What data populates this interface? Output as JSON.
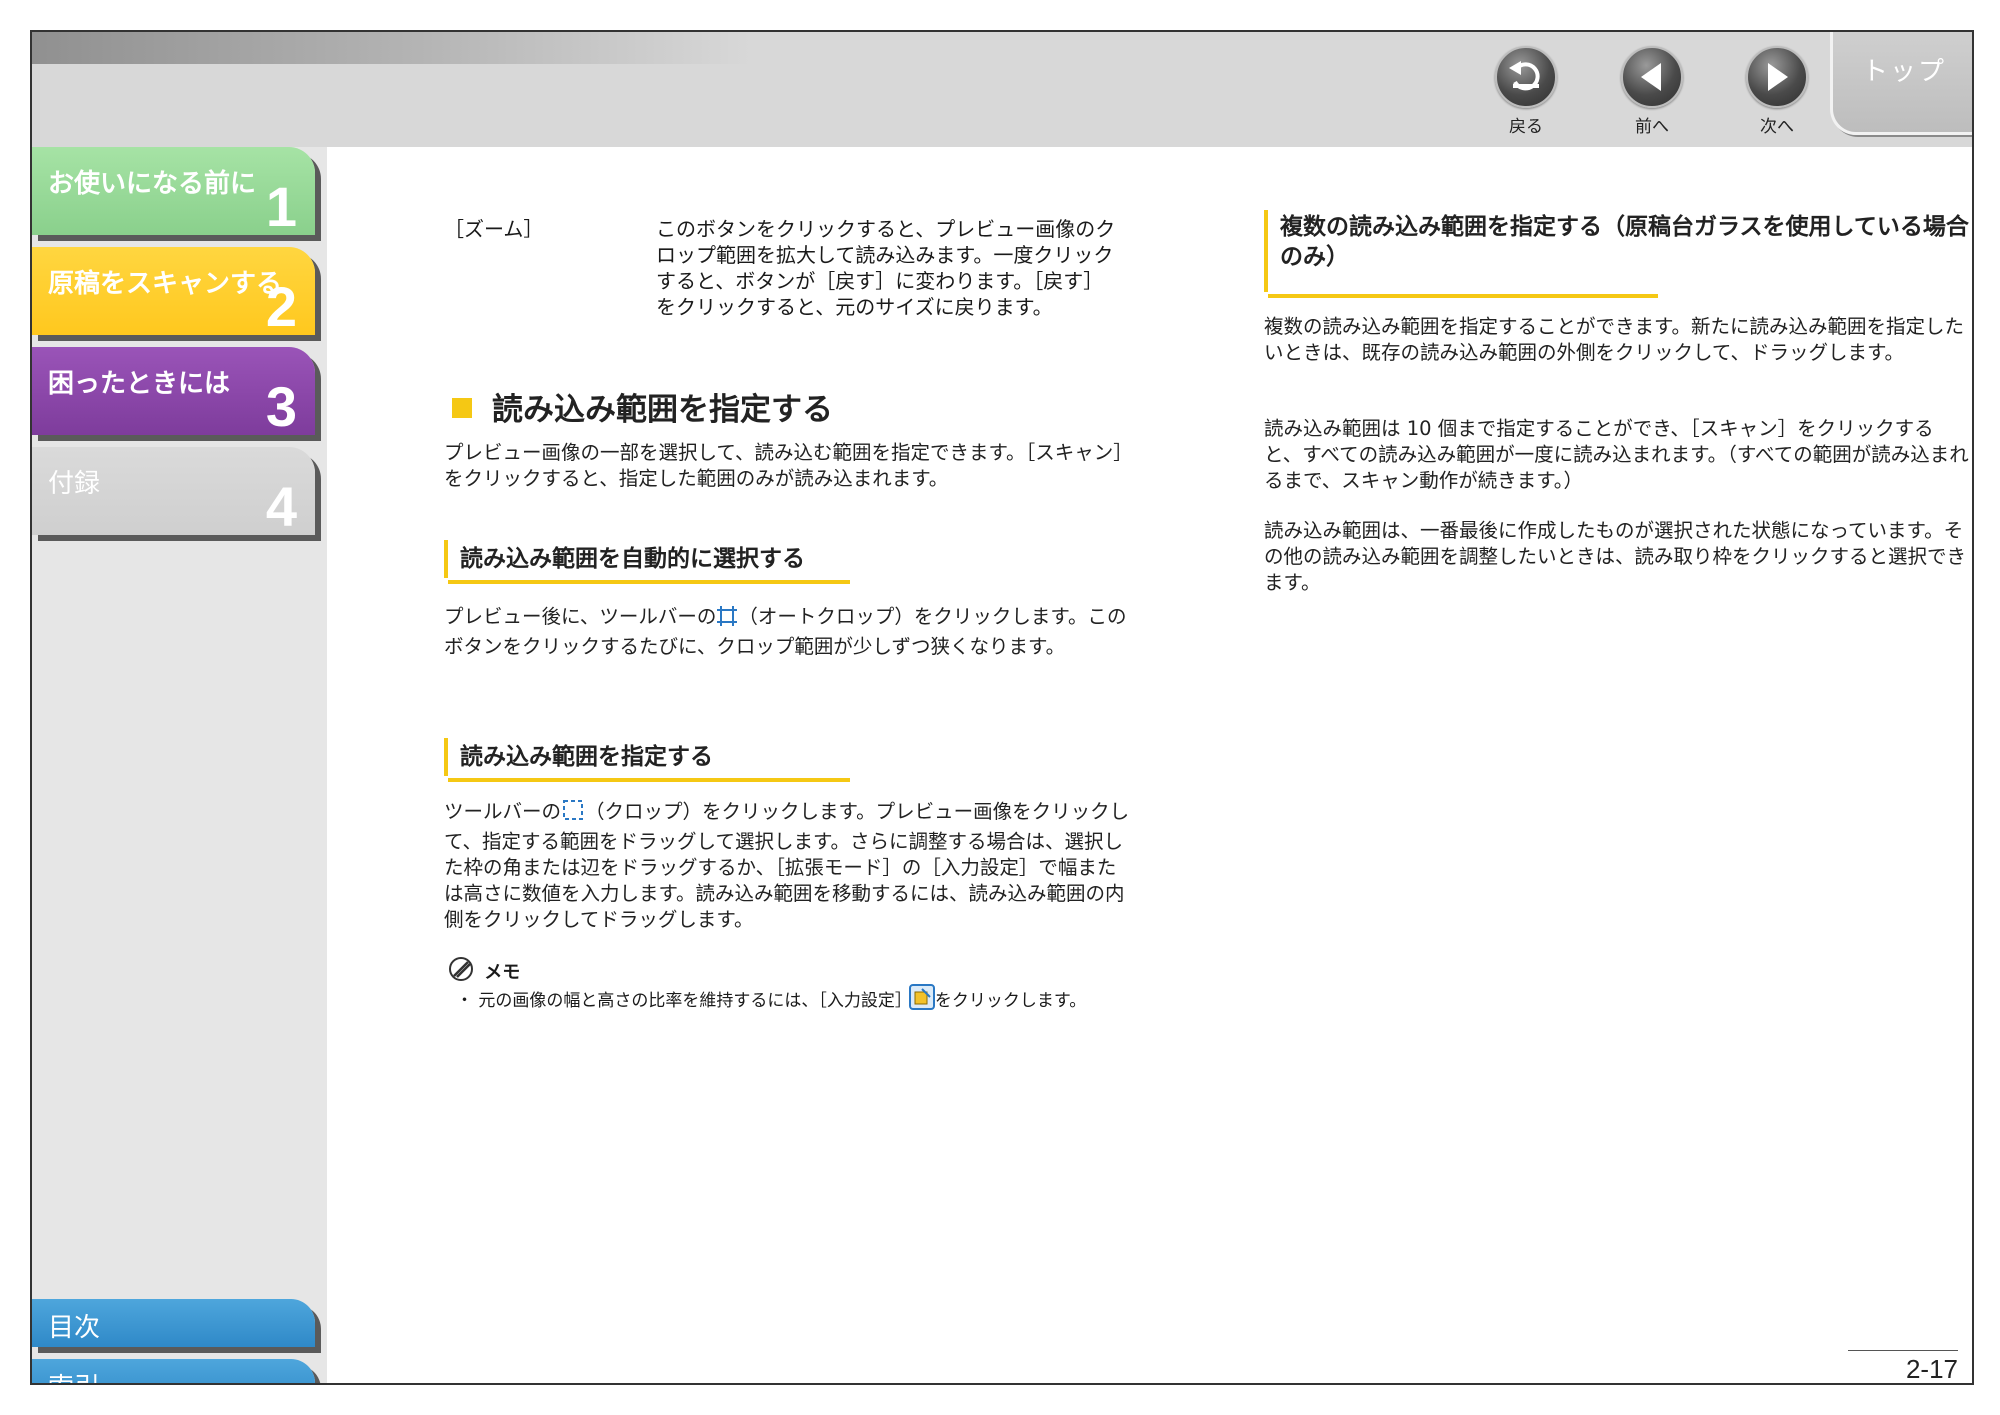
{
  "nav": {
    "back": "戻る",
    "prev": "前へ",
    "next": "次へ",
    "top": "トップ"
  },
  "sidebar": {
    "chapters": [
      {
        "title": "お使いになる前に",
        "num": "1"
      },
      {
        "title": "原稿をスキャンする",
        "num": "2"
      },
      {
        "title": "困ったときには",
        "num": "3"
      },
      {
        "title": "付録",
        "num": "4"
      }
    ],
    "contents": "目次",
    "index": "索引"
  },
  "left": {
    "zoom_label": "［ズーム］",
    "zoom_desc": "このボタンをクリックすると、プレビュー画像のクロップ範囲を拡大して読み込みます。一度クリックすると、ボタンが［戻す］に変わります。［戻す］をクリックすると、元のサイズに戻ります。",
    "h2": "読み込み範囲を指定する",
    "intro": "プレビュー画像の一部を選択して、読み込む範囲を指定できます。［スキャン］をクリックすると、指定した範囲のみが読み込まれます。",
    "auto_h3": "読み込み範囲を自動的に選択する",
    "auto_before": "プレビュー後に、ツールバーの",
    "auto_after": "（オートクロップ）をクリックします。このボタンをクリックするたびに、クロップ範囲が少しずつ狭くなります。",
    "manual_h3": "読み込み範囲を指定する",
    "manual_before": "ツールバーの",
    "manual_after": "（クロップ）をクリックします。プレビュー画像をクリックして、指定する範囲をドラッグして選択します。さらに調整する場合は、選択した枠の角または辺をドラッグするか、［拡張モード］の［入力設定］で幅または高さに数値を入力します。読み込み範囲を移動するには、読み込み範囲の内側をクリックしてドラッグします。",
    "memo_title": "メモ",
    "memo_before": "・ 元の画像の幅と高さの比率を維持するには、［入力設定］で",
    "memo_after": "をクリックします。"
  },
  "right": {
    "h3": "複数の読み込み範囲を指定する（原稿台ガラスを使用している場合のみ）",
    "p1": "複数の読み込み範囲を指定することができます。新たに読み込み範囲を指定したいときは、既存の読み込み範囲の外側をクリックして、ドラッグします。",
    "p2": "読み込み範囲は 10 個まで指定することができ、［スキャン］をクリックすると、すべての読み込み範囲が一度に読み込まれます。（すべての範囲が読み込まれるまで、スキャン動作が続きます。）",
    "p3": "読み込み範囲は、一番最後に作成したものが選択された状態になっています。その他の読み込み範囲を調整したいときは、読み取り枠をクリックすると選択できます。"
  },
  "page_number": "2-17"
}
